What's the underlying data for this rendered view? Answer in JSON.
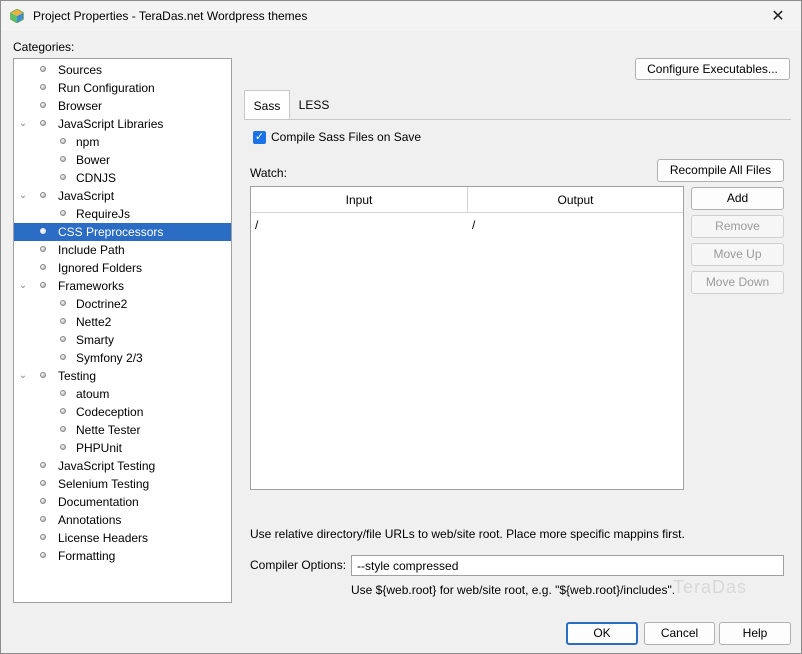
{
  "window": {
    "title": "Project Properties - TeraDas.net Wordpress themes",
    "close_glyph": "✕"
  },
  "categories": {
    "label": "Categories:",
    "items": [
      {
        "label": "Sources",
        "level": 0,
        "expanded": null,
        "selected": false
      },
      {
        "label": "Run Configuration",
        "level": 0,
        "expanded": null,
        "selected": false
      },
      {
        "label": "Browser",
        "level": 0,
        "expanded": null,
        "selected": false
      },
      {
        "label": "JavaScript Libraries",
        "level": 0,
        "expanded": true,
        "selected": false
      },
      {
        "label": "npm",
        "level": 1,
        "expanded": null,
        "selected": false
      },
      {
        "label": "Bower",
        "level": 1,
        "expanded": null,
        "selected": false
      },
      {
        "label": "CDNJS",
        "level": 1,
        "expanded": null,
        "selected": false
      },
      {
        "label": "JavaScript",
        "level": 0,
        "expanded": true,
        "selected": false
      },
      {
        "label": "RequireJs",
        "level": 1,
        "expanded": null,
        "selected": false
      },
      {
        "label": "CSS Preprocessors",
        "level": 0,
        "expanded": null,
        "selected": true
      },
      {
        "label": "Include Path",
        "level": 0,
        "expanded": null,
        "selected": false
      },
      {
        "label": "Ignored Folders",
        "level": 0,
        "expanded": null,
        "selected": false
      },
      {
        "label": "Frameworks",
        "level": 0,
        "expanded": true,
        "selected": false
      },
      {
        "label": "Doctrine2",
        "level": 1,
        "expanded": null,
        "selected": false
      },
      {
        "label": "Nette2",
        "level": 1,
        "expanded": null,
        "selected": false
      },
      {
        "label": "Smarty",
        "level": 1,
        "expanded": null,
        "selected": false
      },
      {
        "label": "Symfony 2/3",
        "level": 1,
        "expanded": null,
        "selected": false
      },
      {
        "label": "Testing",
        "level": 0,
        "expanded": true,
        "selected": false
      },
      {
        "label": "atoum",
        "level": 1,
        "expanded": null,
        "selected": false
      },
      {
        "label": "Codeception",
        "level": 1,
        "expanded": null,
        "selected": false
      },
      {
        "label": "Nette Tester",
        "level": 1,
        "expanded": null,
        "selected": false
      },
      {
        "label": "PHPUnit",
        "level": 1,
        "expanded": null,
        "selected": false
      },
      {
        "label": "JavaScript Testing",
        "level": 0,
        "expanded": null,
        "selected": false
      },
      {
        "label": "Selenium Testing",
        "level": 0,
        "expanded": null,
        "selected": false
      },
      {
        "label": "Documentation",
        "level": 0,
        "expanded": null,
        "selected": false
      },
      {
        "label": "Annotations",
        "level": 0,
        "expanded": null,
        "selected": false
      },
      {
        "label": "License Headers",
        "level": 0,
        "expanded": null,
        "selected": false
      },
      {
        "label": "Formatting",
        "level": 0,
        "expanded": null,
        "selected": false
      }
    ]
  },
  "configure_executables": "Configure Executables...",
  "tabs": [
    {
      "label": "Sass",
      "active": true
    },
    {
      "label": "LESS",
      "active": false
    }
  ],
  "compile_on_save": {
    "label": "Compile Sass Files on Save",
    "checked": true
  },
  "watch": {
    "label": "Watch:",
    "recompile_label": "Recompile All Files",
    "columns": [
      "Input",
      "Output"
    ],
    "rows": [
      [
        "/",
        "/"
      ]
    ],
    "buttons": {
      "add": "Add",
      "remove": "Remove",
      "move_up": "Move Up",
      "move_down": "Move Down"
    }
  },
  "hint": "Use relative directory/file URLs to web/site root. Place more specific mappins first.",
  "compiler_options": {
    "label": "Compiler Options:",
    "value": "--style compressed",
    "hint": "Use ${web.root} for web/site root, e.g. \"${web.root}/includes\"."
  },
  "footer": {
    "ok": "OK",
    "cancel": "Cancel",
    "help": "Help"
  },
  "watermark": "TeraDas",
  "colors": {
    "selection": "#2b6cc4",
    "checkbox": "#1a73e8",
    "primary_border": "#2b6cc4"
  }
}
